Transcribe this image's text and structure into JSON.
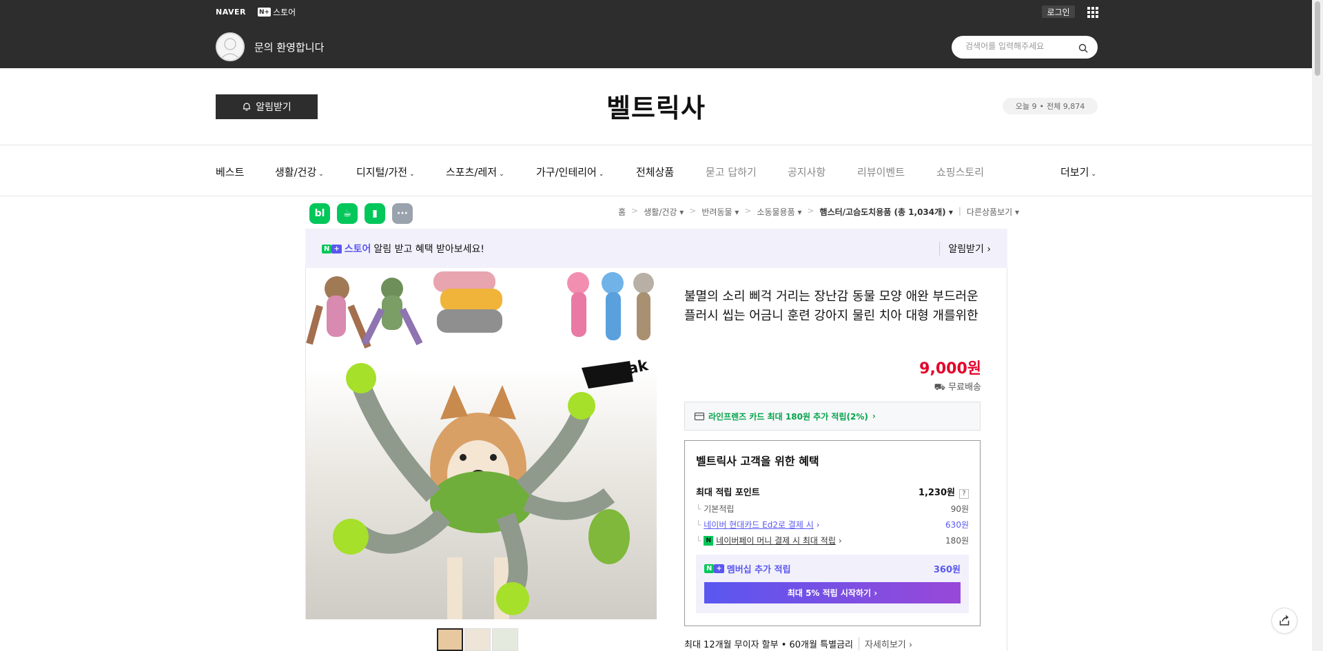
{
  "topbar": {
    "naver_logo": "NAVER",
    "nplus_n": "N",
    "nplus_label": "스토어",
    "login": "로그인",
    "welcome": "문의 환영합니다",
    "search_placeholder": "검색어를 입력해주세요"
  },
  "store": {
    "alarm_button": "알림받기",
    "title": "벨트릭사",
    "visitor_today": "오늘 9",
    "visitor_total": "전체 9,874"
  },
  "nav": {
    "items": [
      {
        "label": "베스트"
      },
      {
        "label": "생활/건강"
      },
      {
        "label": "디지털/가전"
      },
      {
        "label": "스포츠/레저"
      },
      {
        "label": "가구/인테리어"
      },
      {
        "label": "전체상품"
      },
      {
        "label": "묻고 답하기"
      },
      {
        "label": "공지사항"
      },
      {
        "label": "리뷰이벤트"
      },
      {
        "label": "쇼핑스토리"
      }
    ],
    "more": "더보기"
  },
  "app_icons": [
    "bl",
    "☕",
    "▮",
    "···"
  ],
  "breadcrumb": {
    "home": "홈",
    "c1": "생활/건강",
    "c2": "반려동물",
    "c3": "소동물용품",
    "c4": "햄스터/고슴도치용품 (총 1,034개)",
    "other": "다른상품보기"
  },
  "promo": {
    "n": "N",
    "plus": "+",
    "store": "스토어",
    "text": "알림 받고 혜택 받아보세요!",
    "right": "알림받기"
  },
  "product": {
    "title": "불멸의 소리 삐걱 거리는 장난감 동물 모양 애완 부드러운 플러시 씹는 어금니 훈련 강아지 물린 치아 대형 개를위한",
    "price": "9,000원",
    "shipping": "무료배송",
    "card_promo": "라인프렌즈 카드 최대 180원 추가 적립(2%)",
    "image_text": "squeak"
  },
  "benefit": {
    "title": "벨트릭사 고객을 위한 혜택",
    "max_point_label": "최대 적립 포인트",
    "max_point_value": "1,230원",
    "help": "?",
    "basic_label": "기본적립",
    "basic_value": "90원",
    "card_label": "네이버 현대카드 Ed2로 결제 시",
    "card_value": "630원",
    "npay_label": "네이버페이 머니 결제 시 최대 적립",
    "npay_value": "180원",
    "npay_icon": "N",
    "member_label": "멤버십 추가 적립",
    "member_value": "360원",
    "member_button": "최대 5% 적립 시작하기"
  },
  "installment": {
    "text": "최대 12개월 무이자 할부 • 60개월 특별금리",
    "more": "자세히보기"
  },
  "colors": {
    "dark_bar": "#2d2d2d",
    "price_red": "#e3002a",
    "naver_green": "#03c75a",
    "nplus_purple": "#5a57f0"
  }
}
